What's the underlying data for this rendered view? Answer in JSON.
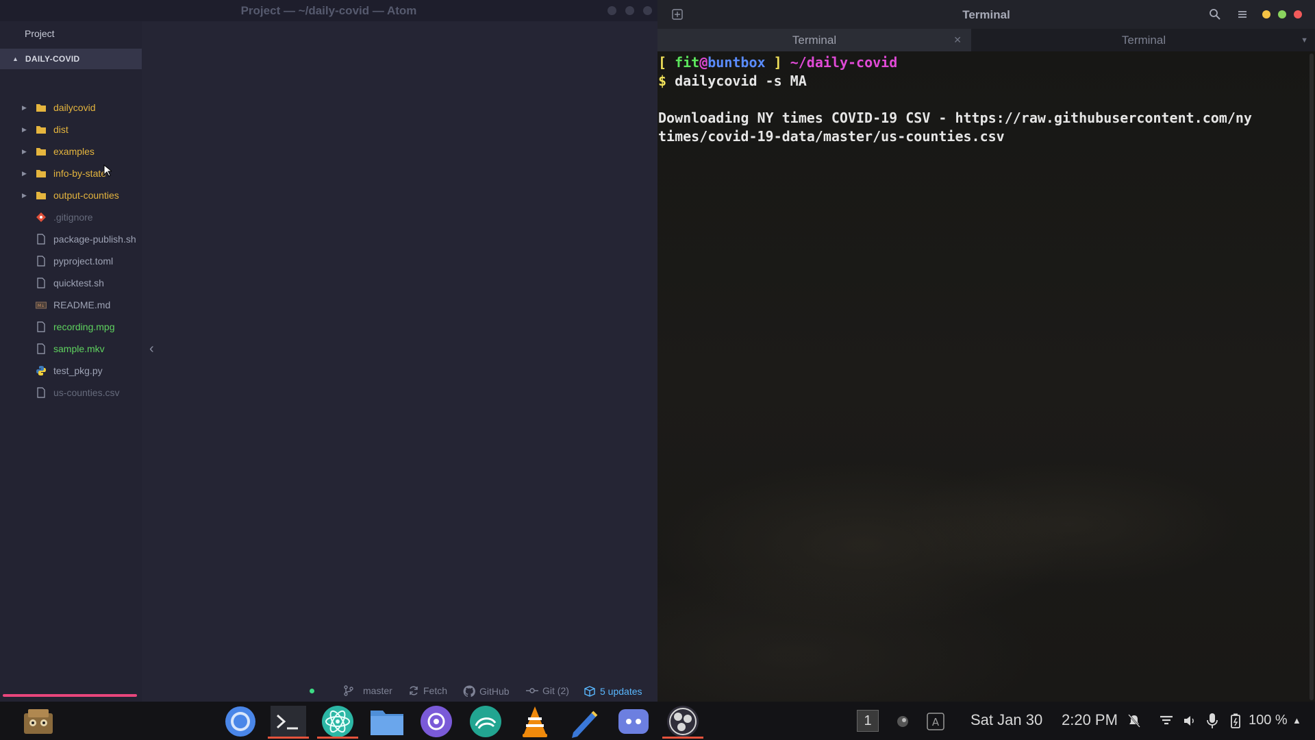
{
  "atom": {
    "title": "Project — ~/daily-covid — Atom",
    "sidebar": {
      "header": "Project",
      "root": "DAILY-COVID",
      "items": [
        {
          "label": "dailycovid",
          "type": "folder",
          "color": "folder"
        },
        {
          "label": "dist",
          "type": "folder",
          "color": "folder"
        },
        {
          "label": "examples",
          "type": "folder",
          "color": "folder"
        },
        {
          "label": "info-by-state",
          "type": "folder",
          "color": "folder"
        },
        {
          "label": "output-counties",
          "type": "folder",
          "color": "folder"
        },
        {
          "label": ".gitignore",
          "type": "git",
          "color": "dim"
        },
        {
          "label": "package-publish.sh",
          "type": "file",
          "color": "file"
        },
        {
          "label": "pyproject.toml",
          "type": "file",
          "color": "file"
        },
        {
          "label": "quicktest.sh",
          "type": "file",
          "color": "file"
        },
        {
          "label": "README.md",
          "type": "markdown",
          "color": "file"
        },
        {
          "label": "recording.mpg",
          "type": "file",
          "color": "green"
        },
        {
          "label": "sample.mkv",
          "type": "file",
          "color": "green"
        },
        {
          "label": "test_pkg.py",
          "type": "python",
          "color": "file"
        },
        {
          "label": "us-counties.csv",
          "type": "file",
          "color": "dim"
        }
      ]
    },
    "status_bar": {
      "branch": "master",
      "fetch": "Fetch",
      "github": "GitHub",
      "git": "Git (2)",
      "updates": "5 updates"
    }
  },
  "terminal": {
    "title": "Terminal",
    "tabs": [
      {
        "label": "Terminal",
        "active": true
      },
      {
        "label": "Terminal",
        "active": false
      }
    ],
    "prompt": {
      "open_bracket": "[",
      "user": "fit",
      "at": "@",
      "host": "buntbox",
      "close_bracket": "]",
      "path": "~/daily-covid",
      "symbol": "$",
      "command": "dailycovid -s MA"
    },
    "output": [
      "Downloading NY times COVID-19 CSV - https://raw.githubusercontent.com/ny",
      "times/covid-19-data/master/us-counties.csv"
    ]
  },
  "taskbar": {
    "workspace": "1",
    "date": "Sat Jan 30",
    "time": "2:20 PM",
    "battery": "100 %",
    "dock": [
      "files-manager-icon",
      "chromium-icon",
      "terminal-icon",
      "atom-icon",
      "files-icon",
      "camera-app-icon",
      "audio-app-icon",
      "vlc-icon",
      "text-editor-icon",
      "discord-icon",
      "obs-icon"
    ]
  },
  "colors": {
    "accent_pink": "#e8467c",
    "prompt_yellow": "#f2e35a",
    "prompt_green": "#5ce65c",
    "prompt_blue": "#5a8cff",
    "prompt_magenta": "#e04ad6",
    "folder": "#e5b53e"
  }
}
